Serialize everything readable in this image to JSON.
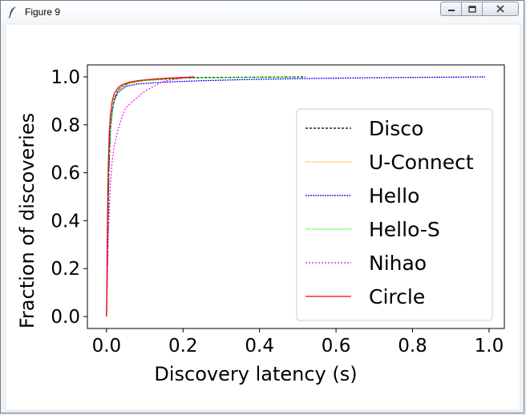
{
  "window": {
    "title": "Figure 9"
  },
  "colors": {
    "axes_bg": "#ffffff",
    "frame": "#000000"
  },
  "chart_data": {
    "type": "line",
    "xlabel": "Discovery latency (s)",
    "ylabel": "Fraction of discoveries",
    "xlim": [
      -0.05,
      1.04
    ],
    "ylim": [
      -0.05,
      1.05
    ],
    "xticks": [
      0.0,
      0.2,
      0.4,
      0.6,
      0.8,
      1.0
    ],
    "yticks": [
      0.0,
      0.2,
      0.4,
      0.6,
      0.8,
      1.0
    ],
    "xtick_labels": [
      "0.0",
      "0.2",
      "0.4",
      "0.6",
      "0.8",
      "1.0"
    ],
    "ytick_labels": [
      "0.0",
      "0.2",
      "0.4",
      "0.6",
      "0.8",
      "1.0"
    ],
    "grid": false,
    "legend_position": "center-right",
    "series": [
      {
        "name": "Disco",
        "color": "#000000",
        "dash": "3,2",
        "x": [
          0.0,
          0.003,
          0.006,
          0.01,
          0.015,
          0.02,
          0.03,
          0.04,
          0.06,
          0.1,
          0.15,
          0.2,
          0.23,
          0.3,
          0.4,
          0.52
        ],
        "y": [
          0.0,
          0.3,
          0.6,
          0.78,
          0.86,
          0.91,
          0.945,
          0.96,
          0.975,
          0.985,
          0.99,
          0.995,
          0.997,
          0.998,
          0.999,
          1.0
        ]
      },
      {
        "name": "U-Connect",
        "color": "#ffa500",
        "dash": "1,1",
        "x": [
          0.0,
          0.003,
          0.006,
          0.01,
          0.015,
          0.02,
          0.03,
          0.04,
          0.06,
          0.1,
          0.15,
          0.2,
          0.23
        ],
        "y": [
          0.0,
          0.28,
          0.58,
          0.76,
          0.85,
          0.9,
          0.94,
          0.955,
          0.972,
          0.985,
          0.992,
          0.997,
          1.0
        ]
      },
      {
        "name": "Hello",
        "color": "#0000ff",
        "dash": "2,1",
        "x": [
          0.0,
          0.003,
          0.006,
          0.01,
          0.015,
          0.02,
          0.03,
          0.05,
          0.08,
          0.15,
          0.25,
          0.4,
          0.6,
          0.8,
          0.99
        ],
        "y": [
          0.0,
          0.3,
          0.6,
          0.78,
          0.86,
          0.9,
          0.935,
          0.96,
          0.97,
          0.978,
          0.984,
          0.99,
          0.995,
          0.998,
          1.0
        ]
      },
      {
        "name": "Hello-S",
        "color": "#00ff00",
        "dash": "1,1",
        "x": [
          0.0,
          0.003,
          0.006,
          0.01,
          0.015,
          0.02,
          0.03,
          0.04,
          0.06,
          0.1,
          0.2,
          0.3,
          0.4,
          0.5
        ],
        "y": [
          0.0,
          0.3,
          0.6,
          0.78,
          0.86,
          0.91,
          0.945,
          0.96,
          0.975,
          0.985,
          0.994,
          0.997,
          0.999,
          1.0
        ]
      },
      {
        "name": "Nihao",
        "color": "#ff00ff",
        "dash": "2,2",
        "x": [
          0.0,
          0.002,
          0.005,
          0.01,
          0.015,
          0.02,
          0.03,
          0.04,
          0.05,
          0.07,
          0.1,
          0.14,
          0.16,
          0.2,
          0.23
        ],
        "y": [
          0.0,
          0.15,
          0.35,
          0.55,
          0.65,
          0.71,
          0.78,
          0.83,
          0.87,
          0.9,
          0.94,
          0.975,
          0.985,
          0.995,
          1.0
        ]
      },
      {
        "name": "Circle",
        "color": "#ff0000",
        "dash": "",
        "x": [
          0.0,
          0.002,
          0.004,
          0.007,
          0.01,
          0.015,
          0.02,
          0.03,
          0.04,
          0.06,
          0.08,
          0.12,
          0.16,
          0.2,
          0.23
        ],
        "y": [
          0.0,
          0.35,
          0.6,
          0.76,
          0.84,
          0.9,
          0.93,
          0.955,
          0.967,
          0.978,
          0.984,
          0.99,
          0.995,
          0.998,
          1.0
        ]
      }
    ]
  }
}
